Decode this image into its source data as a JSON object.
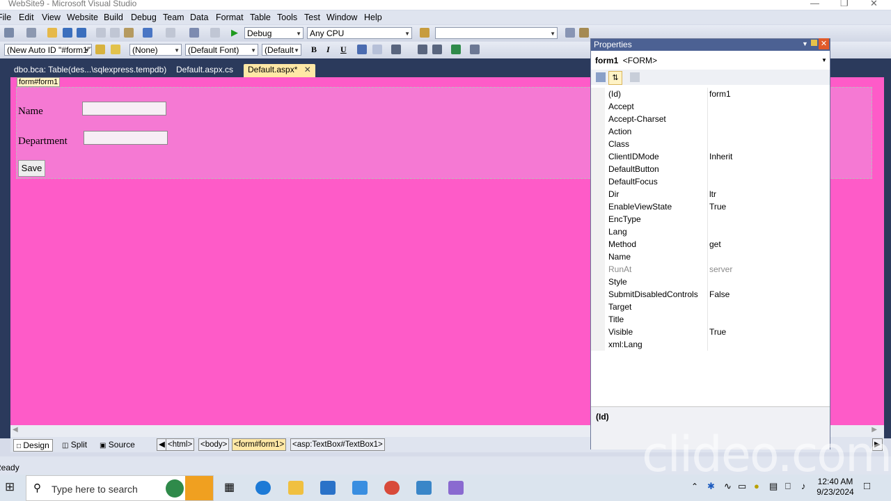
{
  "window": {
    "title": "WebSite9 - Microsoft Visual Studio"
  },
  "menu": [
    "File",
    "Edit",
    "View",
    "Website",
    "Build",
    "Debug",
    "Team",
    "Data",
    "Format",
    "Table",
    "Tools",
    "Test",
    "Window",
    "Help"
  ],
  "toolbar1": {
    "config": "Debug",
    "platform": "Any CPU",
    "find": ""
  },
  "toolbar2": {
    "target_rule": "(New Auto ID \"#form1\")",
    "block_format": "(None)",
    "font_name": "(Default Font)",
    "font_size": "(Default",
    "bold": "B",
    "italic": "I",
    "underline": "U"
  },
  "tabs": [
    {
      "label": "dbo.bca: Table(des...\\sqlexpress.tempdb)",
      "active": false
    },
    {
      "label": "Default.aspx.cs",
      "active": false
    },
    {
      "label": "Default.aspx*",
      "active": true
    }
  ],
  "designer": {
    "form_tag": "form#form1",
    "name_label": "Name",
    "department_label": "Department",
    "save_button": "Save",
    "background": "#fe5bc8"
  },
  "view_bar": {
    "views": [
      "Design",
      "Split",
      "Source"
    ],
    "crumbs": [
      "<html>",
      "<body>",
      "<form#form1>",
      "<asp:TextBox#TextBox1>"
    ]
  },
  "status": {
    "text": "Ready"
  },
  "properties": {
    "title": "Properties",
    "object_name": "form1",
    "object_type": "<FORM>",
    "rows": [
      {
        "name": "(Id)",
        "value": "form1"
      },
      {
        "name": "Accept",
        "value": ""
      },
      {
        "name": "Accept-Charset",
        "value": ""
      },
      {
        "name": "Action",
        "value": ""
      },
      {
        "name": "Class",
        "value": ""
      },
      {
        "name": "ClientIDMode",
        "value": "Inherit"
      },
      {
        "name": "DefaultButton",
        "value": ""
      },
      {
        "name": "DefaultFocus",
        "value": ""
      },
      {
        "name": "Dir",
        "value": "ltr"
      },
      {
        "name": "EnableViewState",
        "value": "True"
      },
      {
        "name": "EncType",
        "value": ""
      },
      {
        "name": "Lang",
        "value": ""
      },
      {
        "name": "Method",
        "value": "get"
      },
      {
        "name": "Name",
        "value": ""
      },
      {
        "name": "RunAt",
        "value": "server"
      },
      {
        "name": "Style",
        "value": ""
      },
      {
        "name": "SubmitDisabledControls",
        "value": "False"
      },
      {
        "name": "Target",
        "value": ""
      },
      {
        "name": "Title",
        "value": ""
      },
      {
        "name": "Visible",
        "value": "True"
      },
      {
        "name": "xml:Lang",
        "value": ""
      }
    ],
    "description_title": "(Id)"
  },
  "taskbar": {
    "search_placeholder": "Type here to search",
    "time": "12:40 AM",
    "date": "9/23/2024"
  },
  "watermark": "clideo.com"
}
